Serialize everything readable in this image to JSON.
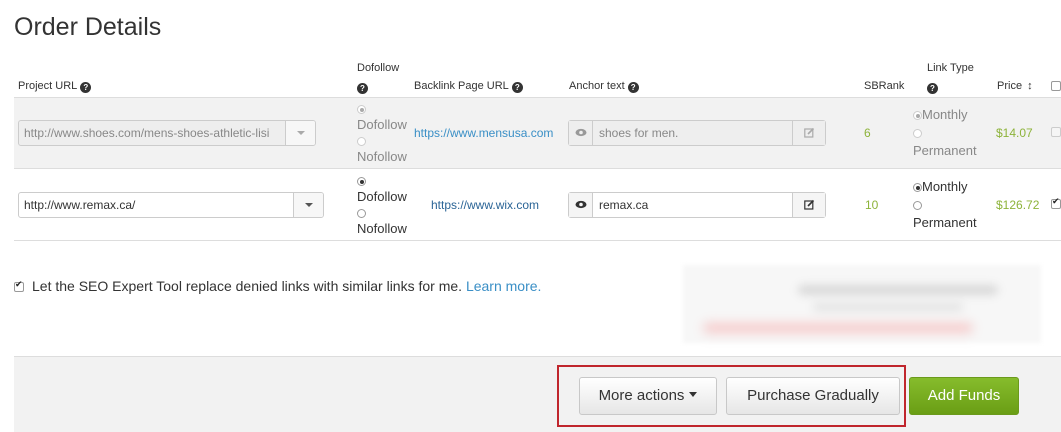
{
  "page_title": "Order Details",
  "columns": {
    "project_url": "Project URL",
    "dofollow": "Dofollow",
    "backlink_page_url": "Backlink Page URL",
    "anchor_text": "Anchor text",
    "sbrank": "SBRank",
    "link_type": "Link Type",
    "price": "Price"
  },
  "help_glyph": "?",
  "sort_glyph": "↕",
  "rows": [
    {
      "project_url": "http://www.shoes.com/mens-shoes-athletic-lisi",
      "dofollow_label": "Dofollow",
      "nofollow_label": "Nofollow",
      "follow_selected": "Dofollow",
      "backlink_url": "https://www.mensusa.com",
      "anchor_text": "shoes for men.",
      "sbrank": "6",
      "monthly_label": "Monthly",
      "permanent_label": "Permanent",
      "link_type_selected": "Monthly",
      "price": "$14.07",
      "selected": false,
      "disabled": true
    },
    {
      "project_url": "http://www.remax.ca/",
      "dofollow_label": "Dofollow",
      "nofollow_label": "Nofollow",
      "follow_selected": "Dofollow",
      "backlink_url": "https://www.wix.com",
      "anchor_text": "remax.ca",
      "sbrank": "10",
      "monthly_label": "Monthly",
      "permanent_label": "Permanent",
      "link_type_selected": "Monthly",
      "price": "$126.72",
      "selected": true,
      "disabled": false
    }
  ],
  "replace_option": {
    "checked": true,
    "text": "Let the SEO Expert Tool replace denied links with similar links for me.",
    "learn_more": "Learn more."
  },
  "footer": {
    "more_actions": "More actions",
    "purchase_gradually": "Purchase Gradually",
    "add_funds": "Add Funds"
  },
  "colors": {
    "accent_link": "#3a8fc6",
    "price_green": "#8db33a",
    "add_funds_green": "#7aad22",
    "highlight_red": "#c0262d"
  },
  "icons": {
    "help": "question-circle-icon",
    "eye": "eye-icon",
    "edit": "edit-icon",
    "sort": "sort-icon",
    "dropdown": "caret-down-icon"
  }
}
